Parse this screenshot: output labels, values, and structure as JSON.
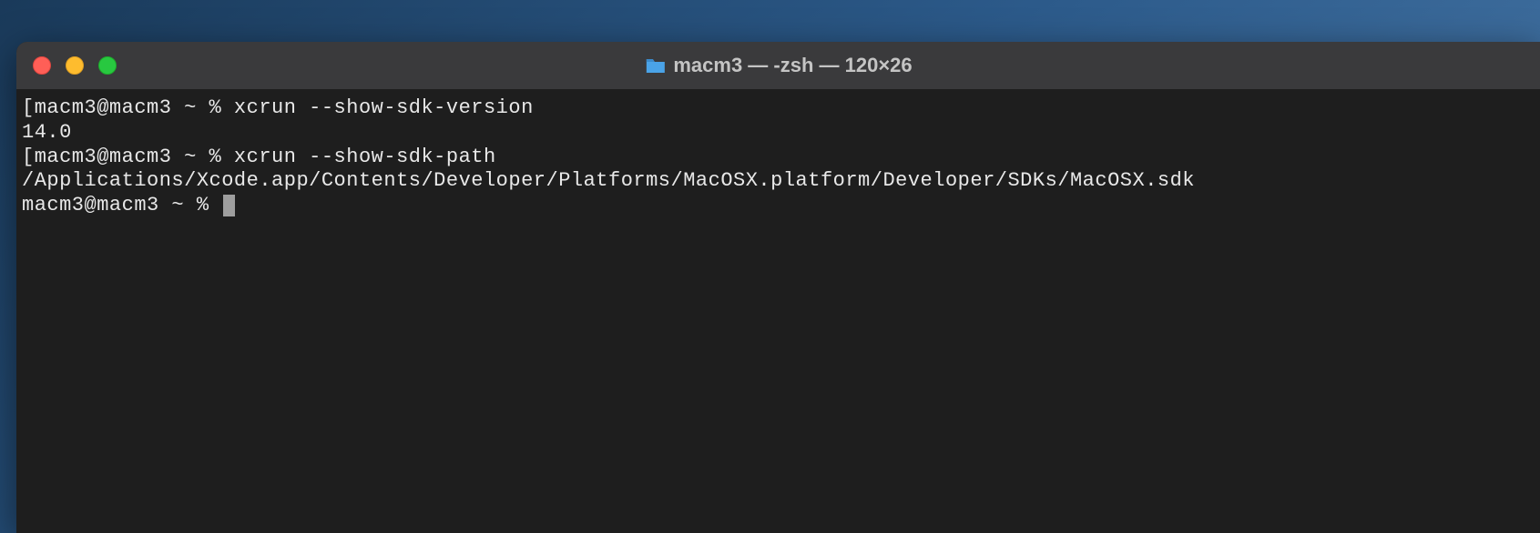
{
  "titlebar": {
    "title": "macm3 — -zsh — 120×26"
  },
  "terminal": {
    "lines": [
      "[macm3@macm3 ~ % xcrun --show-sdk-version",
      "14.0",
      "[macm3@macm3 ~ % xcrun --show-sdk-path",
      "/Applications/Xcode.app/Contents/Developer/Platforms/MacOSX.platform/Developer/SDKs/MacOSX.sdk",
      "macm3@macm3 ~ % "
    ]
  }
}
